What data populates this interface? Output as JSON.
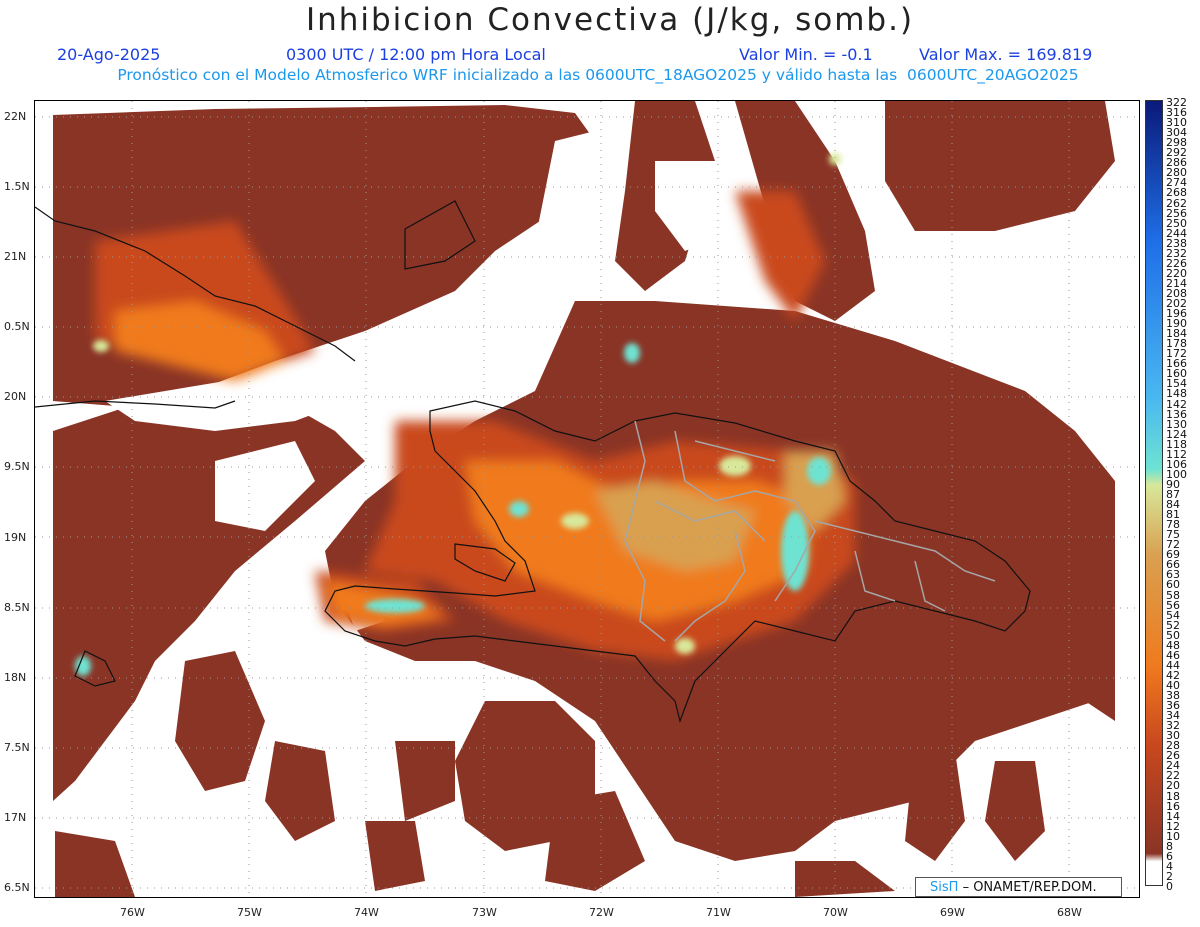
{
  "header": {
    "title": "Inhibicion Convectiva (J/kg, somb.)",
    "date": "20-Ago-2025",
    "time": "0300 UTC / 12:00 pm Hora Local",
    "min_label": "Valor Min. = -0.1",
    "max_label": "Valor Max. = 169.819",
    "subtitle": "Pronóstico con el Modelo Atmosferico WRF inicializado a las 0600UTC_18AGO2025 y válido hasta las  0600UTC_20AGO2025"
  },
  "credit": {
    "brand": "SisΠ",
    "org": "– ONAMET/REP.DOM."
  },
  "map": {
    "lat_labels": [
      "22N",
      "1.5N",
      "21N",
      "0.5N",
      "20N",
      "9.5N",
      "19N",
      "8.5N",
      "18N",
      "7.5N",
      "17N",
      "6.5N"
    ],
    "lon_labels": [
      "76W",
      "75W",
      "74W",
      "73W",
      "72W",
      "71W",
      "70W",
      "69W",
      "68W"
    ]
  },
  "colorbar": {
    "labels": [
      "322",
      "316",
      "310",
      "304",
      "298",
      "292",
      "286",
      "280",
      "274",
      "268",
      "262",
      "256",
      "250",
      "244",
      "238",
      "232",
      "226",
      "220",
      "214",
      "208",
      "202",
      "196",
      "190",
      "184",
      "178",
      "172",
      "166",
      "160",
      "154",
      "148",
      "142",
      "136",
      "130",
      "124",
      "118",
      "112",
      "106",
      "100",
      "90",
      "87",
      "84",
      "81",
      "78",
      "75",
      "72",
      "69",
      "66",
      "63",
      "60",
      "58",
      "56",
      "54",
      "52",
      "50",
      "48",
      "46",
      "44",
      "42",
      "40",
      "38",
      "36",
      "34",
      "32",
      "30",
      "28",
      "26",
      "24",
      "22",
      "20",
      "18",
      "16",
      "14",
      "12",
      "10",
      "8",
      "6",
      "4",
      "2",
      "0"
    ],
    "colors": {
      "deep_blue": "#0a1a7a",
      "blue": "#1f6fe8",
      "light_blue": "#4ab8f0",
      "cyan": "#6ee3d2",
      "pale_green": "#d8e89a",
      "tan": "#d9a050",
      "orange": "#f07a1e",
      "red_orange": "#c9481e",
      "brown": "#8a3426",
      "white": "#ffffff"
    }
  }
}
